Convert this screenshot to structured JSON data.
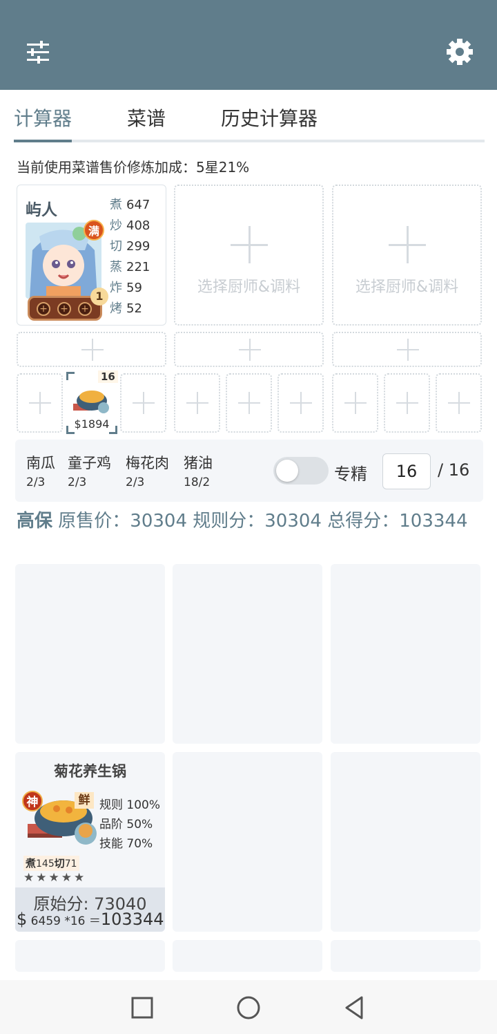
{
  "app_bar": {
    "menu_icon": "sliders-icon",
    "settings_icon": "gear-icon",
    "color": "#607d8b"
  },
  "tabs": [
    {
      "label": "计算器",
      "active": true
    },
    {
      "label": "菜谱",
      "active": false
    },
    {
      "label": "历史计算器",
      "active": false
    }
  ],
  "bonus_line": "当前使用菜谱售价修炼加成：5星21%",
  "chef": {
    "name": "屿人",
    "max_badge": "满",
    "level_badge": "1",
    "skills": [
      {
        "label": "煮",
        "value": "647"
      },
      {
        "label": "炒",
        "value": "408"
      },
      {
        "label": "切",
        "value": "299"
      },
      {
        "label": "蒸",
        "value": "221"
      },
      {
        "label": "炸",
        "value": "59"
      },
      {
        "label": "烤",
        "value": "52"
      }
    ]
  },
  "empty_chef_label": "选择厨师&调料",
  "recipe_slot": {
    "count": "16",
    "price": "$1894"
  },
  "ingredients": [
    {
      "name": "南瓜",
      "count": "2/3"
    },
    {
      "name": "童子鸡",
      "count": "2/3"
    },
    {
      "name": "梅花肉",
      "count": "2/3"
    },
    {
      "name": "猪油",
      "count": "18/2"
    }
  ],
  "specialize": {
    "label": "专精",
    "value": "16",
    "max": "/ 16",
    "enabled": false
  },
  "score": {
    "rank": "高保",
    "text": " 原售价：30304 规则分：30304 总得分：103344"
  },
  "dish": {
    "name": "菊花养生锅",
    "god_badge": "神",
    "fresh_badge": "鲜",
    "stats": [
      "规则 100%",
      "品阶 50%",
      "技能 70%"
    ],
    "skill_a_label": "煮",
    "skill_a_value": "145",
    "skill_b_label": "切",
    "skill_b_value": "71",
    "stars": "★★★★★",
    "original_score": "原始分: 73040",
    "formula_currency": "$",
    "formula_mid": " 6459 *16 ＝",
    "formula_total": "103344"
  },
  "nav": {
    "square_icon": "recent-apps-icon",
    "circle_icon": "home-icon",
    "triangle_icon": "back-icon"
  }
}
